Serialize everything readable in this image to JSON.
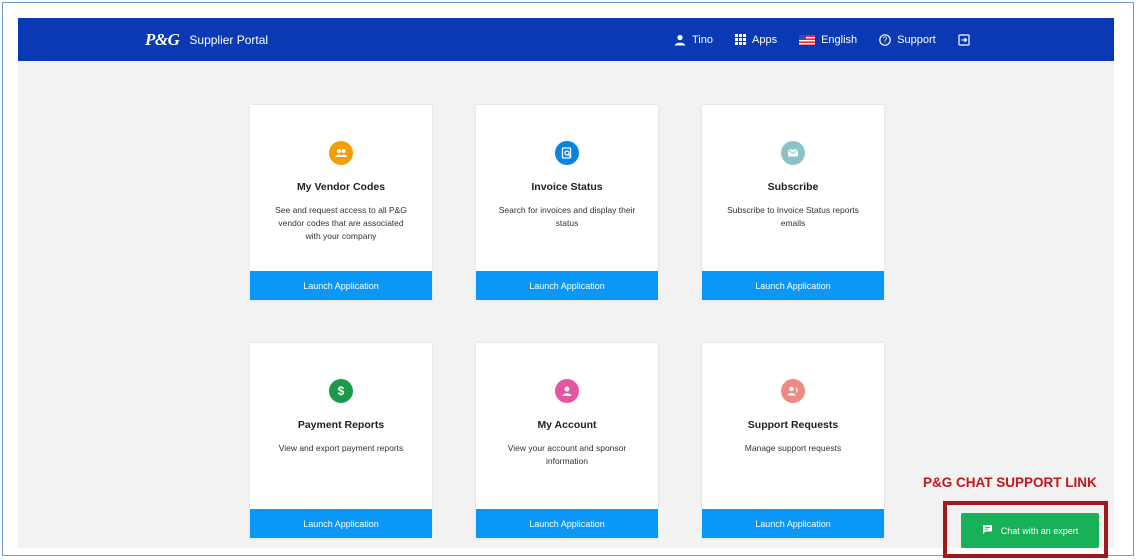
{
  "header": {
    "logo": "P&G",
    "title": "Supplier Portal",
    "nav": {
      "user": "Tino",
      "apps": "Apps",
      "language": "English",
      "support": "Support"
    }
  },
  "cards": [
    {
      "title": "My Vendor Codes",
      "description": "See and request access to all P&G vendor codes that are associated with your company",
      "button": "Launch Application",
      "icon": "vendor-group-icon",
      "color": "#f29f05"
    },
    {
      "title": "Invoice Status",
      "description": "Search for invoices and display their status",
      "button": "Launch Application",
      "icon": "invoice-search-icon",
      "color": "#0a84e0"
    },
    {
      "title": "Subscribe",
      "description": "Subscribe to Invoice Status reports emails",
      "button": "Launch Application",
      "icon": "mail-icon",
      "color": "#8cc3c7"
    },
    {
      "title": "Payment Reports",
      "description": "View and export payment reports",
      "button": "Launch Application",
      "icon": "dollar-icon",
      "color": "#1a9a4a"
    },
    {
      "title": "My Account",
      "description": "View your account and sponsor information",
      "button": "Launch Application",
      "icon": "account-icon",
      "color": "#e4569f"
    },
    {
      "title": "Support Requests",
      "description": "Manage support requests",
      "button": "Launch Application",
      "icon": "support-user-icon",
      "color": "#ee8a7f"
    }
  ],
  "annotation": {
    "label": "P&G CHAT SUPPORT LINK"
  },
  "chat": {
    "label": "Chat with an expert"
  },
  "colors": {
    "header": "#0a3ab3",
    "launch": "#0a97f5",
    "chat": "#18b157",
    "annotation": "#c0161c"
  }
}
